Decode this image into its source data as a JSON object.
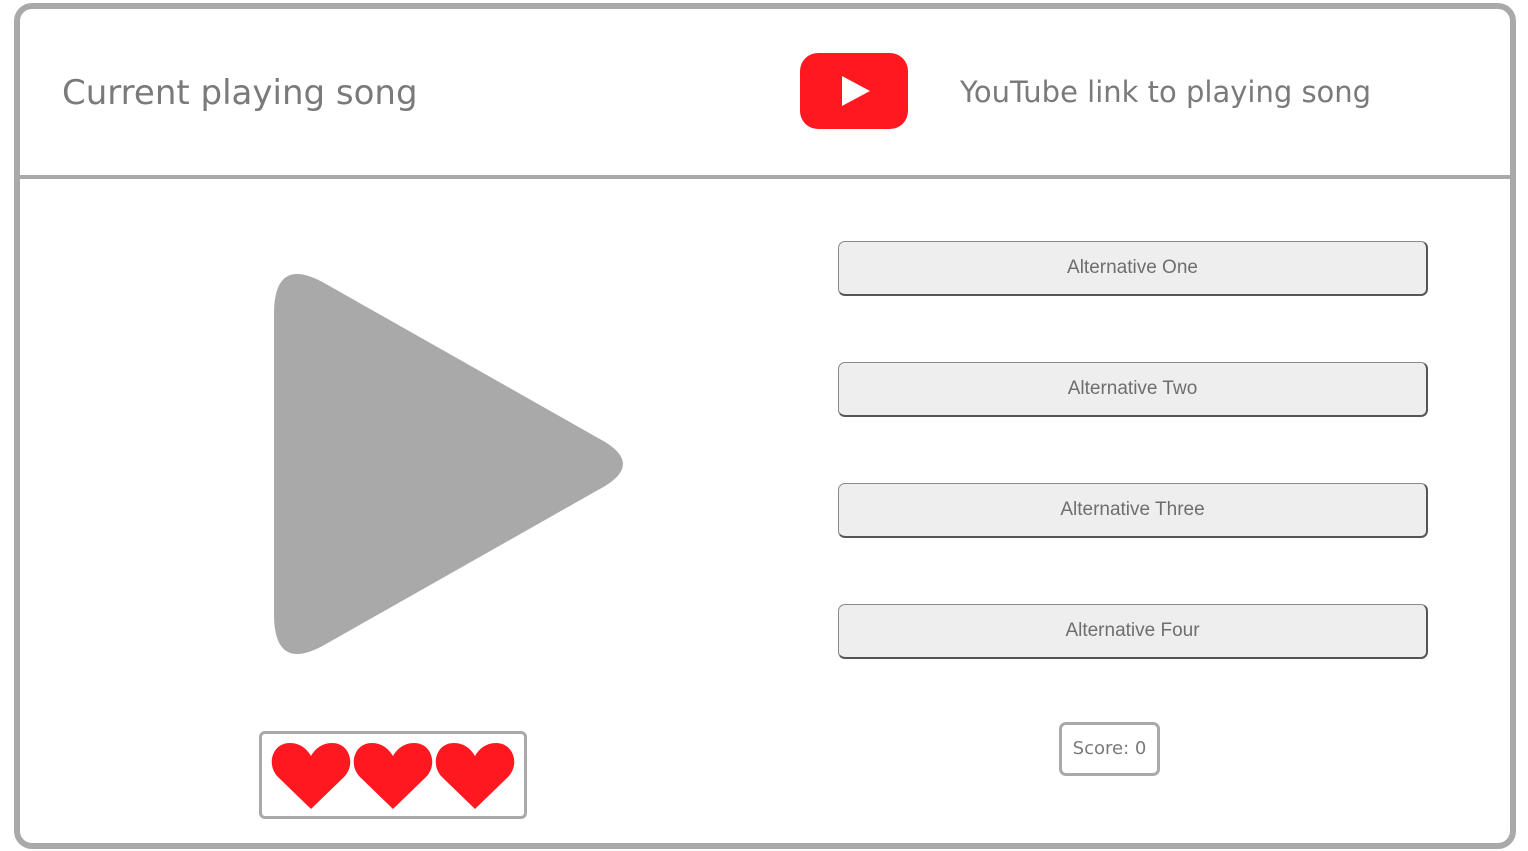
{
  "header": {
    "song_title": "Current playing song",
    "youtube_link_text": "YouTube link to playing song",
    "youtube_icon": "youtube-play-icon"
  },
  "player": {
    "play_icon": "play-icon"
  },
  "alternatives": [
    {
      "label": "Alternative One"
    },
    {
      "label": "Alternative Two"
    },
    {
      "label": "Alternative Three"
    },
    {
      "label": "Alternative Four"
    }
  ],
  "lives": {
    "count": 3,
    "icon": "heart-icon"
  },
  "score": {
    "text": "Score: 0"
  },
  "colors": {
    "accent_red": "#ff1820",
    "frame_gray": "#a9a9a9",
    "play_gray": "#a9a9a9",
    "button_bg": "#eeeeee",
    "text_gray": "#7a7a7a"
  }
}
